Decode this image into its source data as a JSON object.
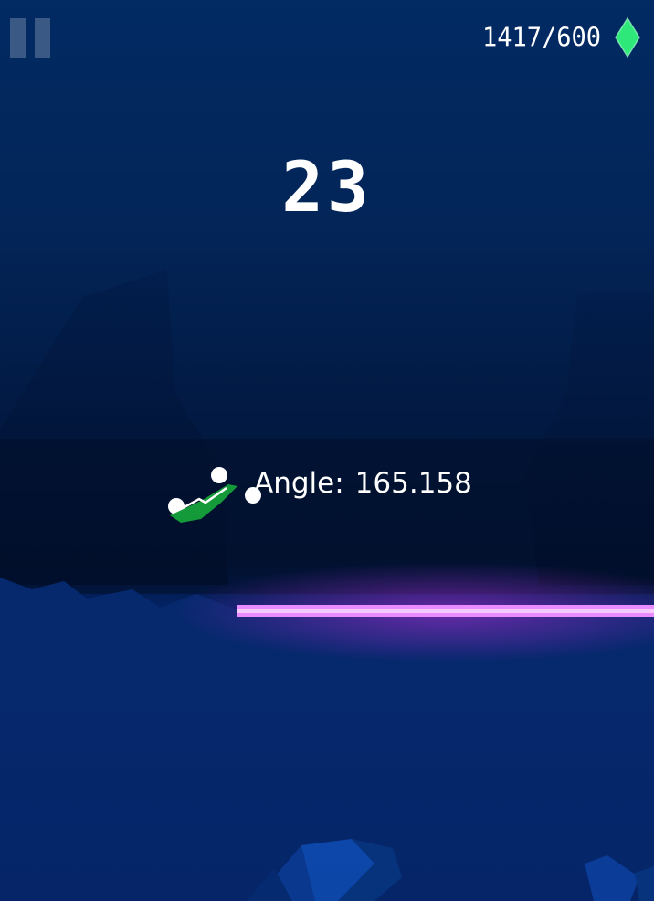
{
  "hud": {
    "pause_label": "Pause",
    "gems": "1417/600",
    "gem_icon": "diamond-gem-icon",
    "gem_color": "#2ee87a"
  },
  "score": "23",
  "debug": {
    "angle_label": "Angle:",
    "angle_value": "165.158"
  },
  "colors": {
    "background": "#022a63",
    "laser": "#e27bff",
    "player": "#159a3a"
  }
}
